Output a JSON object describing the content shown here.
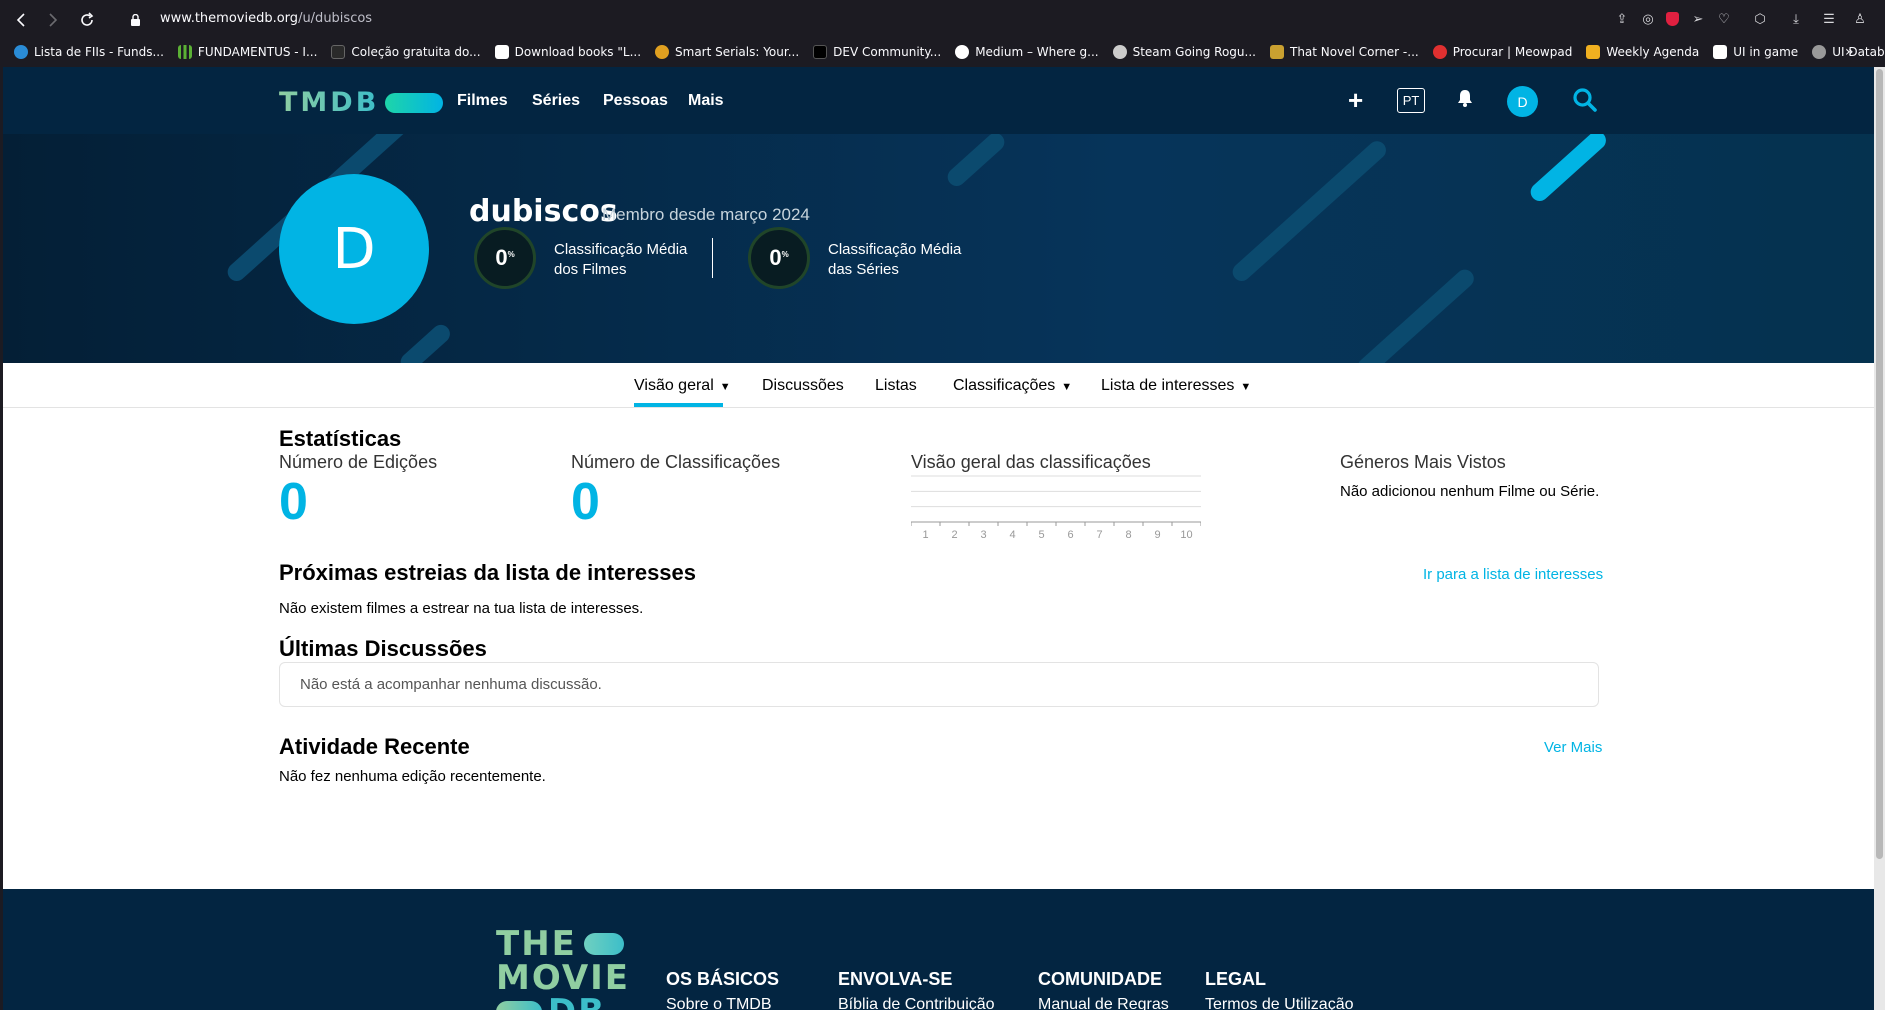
{
  "browser": {
    "url_domain": "www.themoviedb.org",
    "url_path": "/u/dubiscos",
    "bookmarks": [
      {
        "label": "Lista de FIIs - Funds...",
        "color": "#2a8cd6"
      },
      {
        "label": "FUNDAMENTUS - I...",
        "color": "#5bb135"
      },
      {
        "label": "Coleção gratuita do...",
        "color": "#222222"
      },
      {
        "label": "Download books \"L...",
        "color": "#ffffff"
      },
      {
        "label": "Smart Serials: Your...",
        "color": "#e0a020"
      },
      {
        "label": "DEV Community...",
        "color": "#000000"
      },
      {
        "label": "Medium – Where g...",
        "color": "#ffffff"
      },
      {
        "label": "Steam Going Rogu...",
        "color": "#cccccc"
      },
      {
        "label": "That Novel Corner -...",
        "color": "#c9a030"
      },
      {
        "label": "Procurar | Meowpad",
        "color": "#e03030"
      },
      {
        "label": "Weekly Agenda",
        "color": "#f0b020"
      },
      {
        "label": "UI in game",
        "color": "#ffffff"
      },
      {
        "label": "UI Database",
        "color": "#999999"
      }
    ],
    "overflow": "»"
  },
  "header": {
    "logo": "TMDB",
    "menu": [
      "Filmes",
      "Séries",
      "Pessoas",
      "Mais"
    ],
    "lang": "PT",
    "avatar_initial": "D"
  },
  "profile": {
    "avatar_initial": "D",
    "username": "dubiscos",
    "member_since": "Membro desde março 2024",
    "movie_score": "0",
    "movie_score_label_1": "Classificação Média",
    "movie_score_label_2": "dos Filmes",
    "tv_score": "0",
    "tv_score_label_1": "Classificação Média",
    "tv_score_label_2": "das Séries",
    "percent": "%"
  },
  "tabs": {
    "overview": "Visão geral",
    "discussions": "Discussões",
    "lists": "Listas",
    "ratings": "Classificações",
    "watchlist": "Lista de interesses"
  },
  "stats": {
    "title": "Estatísticas",
    "edits_label": "Número de Edições",
    "edits_value": "0",
    "ratings_label": "Número de Classificações",
    "ratings_value": "0",
    "overview_label": "Visão geral das classificações",
    "genres_label": "Géneros Mais Vistos",
    "genres_empty": "Não adicionou nenhum Filme ou Série."
  },
  "chart_data": {
    "type": "bar",
    "categories": [
      "1",
      "2",
      "3",
      "4",
      "5",
      "6",
      "7",
      "8",
      "9",
      "10"
    ],
    "values": [
      0,
      0,
      0,
      0,
      0,
      0,
      0,
      0,
      0,
      0
    ],
    "title": "Visão geral das classificações",
    "xlabel": "",
    "ylabel": "",
    "grid": true
  },
  "upcoming": {
    "title": "Próximas estreias da lista de interesses",
    "link": "Ir para a lista de interesses",
    "empty": "Não existem filmes a estrear na tua lista de interesses."
  },
  "discussions": {
    "title": "Últimas Discussões",
    "empty": "Não está a acompanhar nenhuma discussão."
  },
  "activity": {
    "title": "Atividade Recente",
    "link": "Ver Mais",
    "empty": "Não fez nenhuma edição recentemente."
  },
  "footer": {
    "logo_1": "THE",
    "logo_2": "MOVIE",
    "logo_3": "DB",
    "columns": [
      {
        "title": "OS BÁSICOS",
        "item": "Sobre o TMDB"
      },
      {
        "title": "ENVOLVA-SE",
        "item": "Bíblia de Contribuição"
      },
      {
        "title": "COMUNIDADE",
        "item": "Manual de Regras"
      },
      {
        "title": "LEGAL",
        "item": "Termos de Utilização"
      }
    ]
  },
  "colors": {
    "accent": "#01b4e4",
    "navy": "#032541",
    "logo_green": "#90cea1"
  }
}
